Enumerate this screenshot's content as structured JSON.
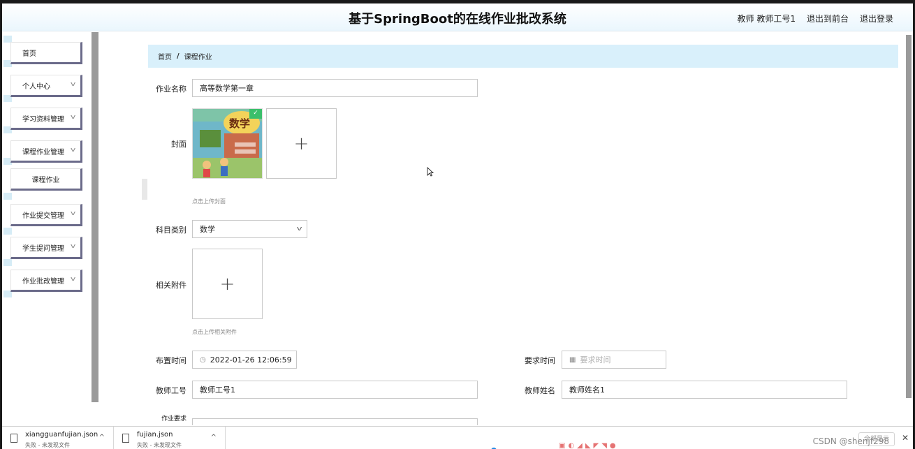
{
  "header": {
    "title": "基于SpringBoot的在线作业批改系统",
    "user": "教师 教师工号1",
    "back_to_front": "退出到前台",
    "logout": "退出登录"
  },
  "sidebar": {
    "items": [
      {
        "label": "首页",
        "has_chevron": false
      },
      {
        "label": "个人中心",
        "has_chevron": true
      },
      {
        "label": "学习资料管理",
        "has_chevron": true
      },
      {
        "label": "课程作业管理",
        "has_chevron": true
      },
      {
        "label": "课程作业",
        "sub": true
      },
      {
        "label": "作业提交管理",
        "has_chevron": true
      },
      {
        "label": "学生提问管理",
        "has_chevron": true
      },
      {
        "label": "作业批改管理",
        "has_chevron": true
      }
    ]
  },
  "breadcrumb": {
    "home": "首页",
    "separator": "/",
    "current": "课程作业"
  },
  "form": {
    "name_label": "作业名称",
    "name_value": "高等数学第一章",
    "cover_label": "封面",
    "cover_hint": "点击上传封面",
    "cover_image_text": "数学",
    "subject_label": "科目类别",
    "subject_value": "数学",
    "attachment_label": "相关附件",
    "attachment_hint": "点击上传相关附件",
    "assign_time_label": "布置时间",
    "assign_time_value": "2022-01-26 12:06:59",
    "due_time_label": "要求时间",
    "due_time_placeholder": "要求时间",
    "teacher_id_label": "教师工号",
    "teacher_id_value": "教师工号1",
    "teacher_name_label": "教师姓名",
    "teacher_name_value": "教师姓名1",
    "requirement_label": "作业要求"
  },
  "downloads": {
    "items": [
      {
        "name": "xiangguanfujian.json",
        "status": "失败 - 未发现文件"
      },
      {
        "name": "fujian.json",
        "status": "失败 - 未发现文件"
      }
    ],
    "watermark": "CSDN @shenjf298",
    "show_all": "全部显示"
  },
  "colors": {
    "breadcrumb_bg": "#d9f0fb",
    "header_bg": "#eaf6fd",
    "menu_border": "#6b6b8a",
    "check_badge": "#3bbf6b"
  }
}
